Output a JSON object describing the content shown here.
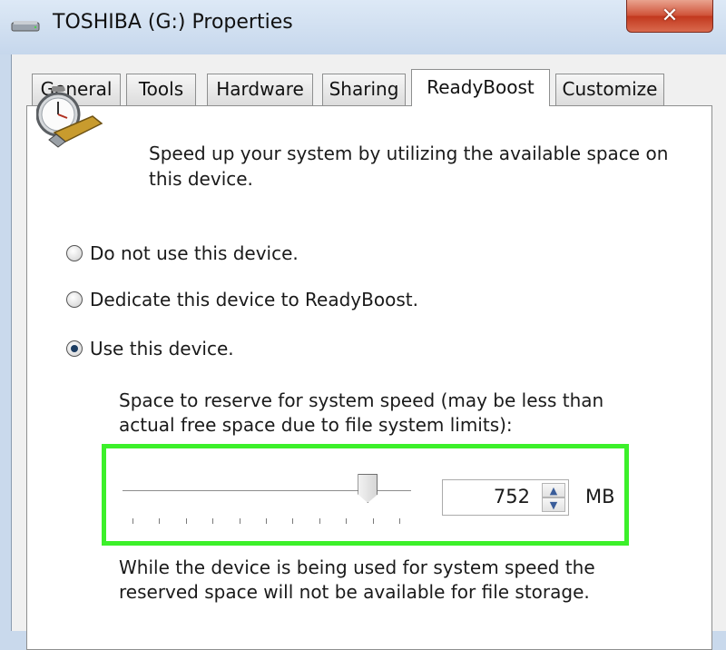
{
  "window": {
    "title": "TOSHIBA (G:) Properties",
    "close_glyph": "✕"
  },
  "tabs": [
    {
      "label": "General",
      "active": false
    },
    {
      "label": "Tools",
      "active": false
    },
    {
      "label": "Hardware",
      "active": false
    },
    {
      "label": "Sharing",
      "active": false
    },
    {
      "label": "ReadyBoost",
      "active": true
    },
    {
      "label": "Customize",
      "active": false
    }
  ],
  "readyboost": {
    "icon": "stopwatch-usb-icon",
    "description": "Speed up your system by utilizing the available space on this device.",
    "options": [
      {
        "label": "Do not use this device.",
        "checked": false
      },
      {
        "label": "Dedicate this device to ReadyBoost.",
        "checked": false
      },
      {
        "label": "Use this device.",
        "checked": true
      }
    ],
    "reserve_label": "Space to reserve for system speed (may be less than actual free space due to file system limits):",
    "slider_fraction": 0.85,
    "value": "752",
    "unit": "MB",
    "note": "While the device is being used for system speed the reserved space will not be available for file storage.",
    "highlight_color": "#3cf02a"
  }
}
